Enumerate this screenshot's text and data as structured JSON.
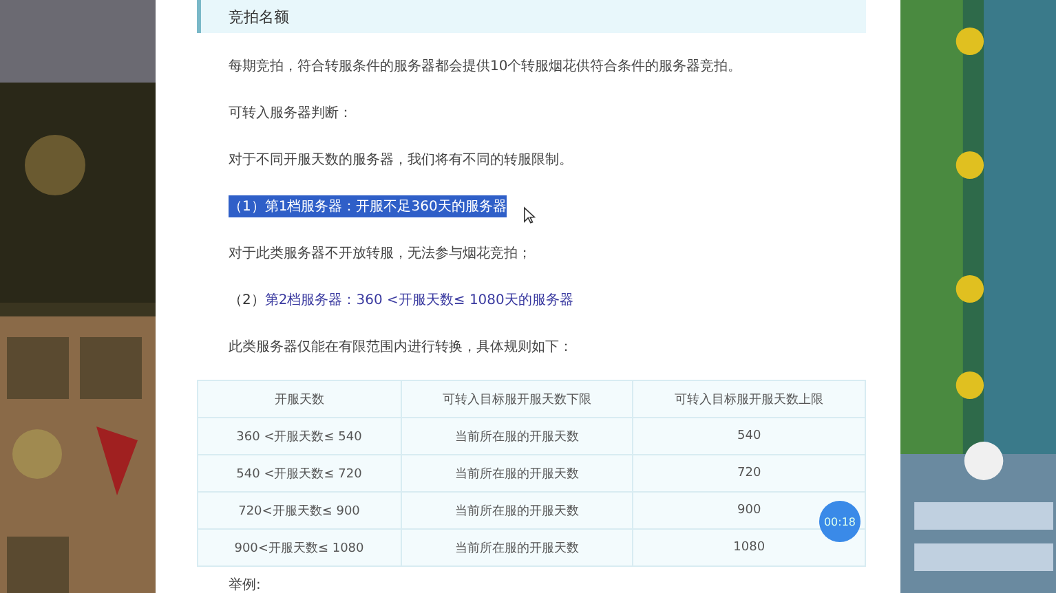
{
  "section_title": "竞拍名额",
  "blocks": [
    {
      "kind": "paragraph",
      "text": "每期竞拍，符合转服条件的服务器都会提供10个转服烟花供符合条件的服务器竞拍。"
    },
    {
      "kind": "paragraph",
      "text": "可转入服务器判断："
    },
    {
      "kind": "paragraph",
      "text": "对于不同开服天数的服务器，我们将有不同的转服限制。"
    },
    {
      "kind": "tier",
      "number": "（1）",
      "text": "第1档服务器：开服不足360天的服务器",
      "highlighted": true
    },
    {
      "kind": "paragraph",
      "text": "对于此类服务器不开放转服，无法参与烟花竞拍；"
    },
    {
      "kind": "tier",
      "number": "（2）",
      "text": "第2档服务器：360 <开服天数≤ 1080天的服务器",
      "highlighted": false
    },
    {
      "kind": "paragraph",
      "text": "此类服务器仅能在有限范围内进行转换，具体规则如下："
    }
  ],
  "table": {
    "columns": [
      "开服天数",
      "可转入目标服开服天数下限",
      "可转入目标服开服天数上限"
    ],
    "rows": [
      [
        "360 <开服天数≤ 540",
        "当前所在服的开服天数",
        "540"
      ],
      [
        "540 <开服天数≤ 720",
        "当前所在服的开服天数",
        "720"
      ],
      [
        "720<开服天数≤ 900",
        "当前所在服的开服天数",
        "900"
      ],
      [
        "900<开服天数≤ 1080",
        "当前所在服的开服天数",
        "1080"
      ]
    ]
  },
  "example_label": "举例:",
  "timer": "00:18"
}
